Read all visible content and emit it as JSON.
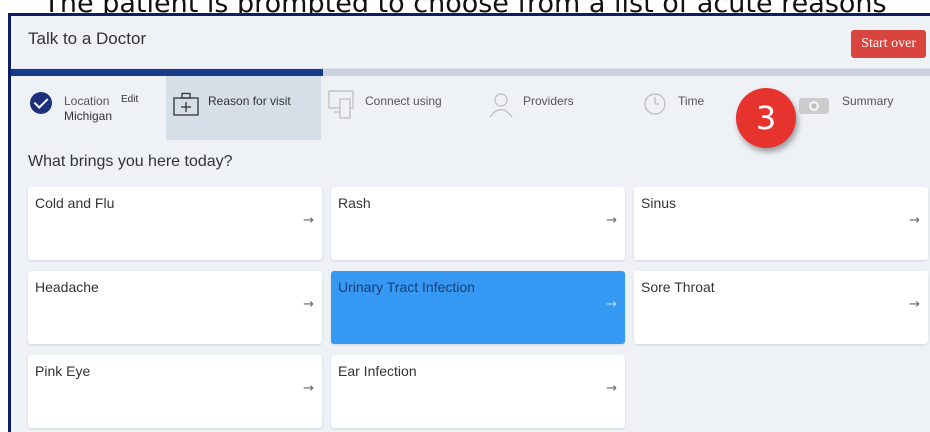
{
  "caption": "The patient is prompted to choose from a list of acute reasons",
  "header": {
    "title": "Talk to a Doctor",
    "start_over_label": "Start over"
  },
  "progress": {
    "completed_fraction": 0.34
  },
  "steps": [
    {
      "label": "Location",
      "edit_label": "Edit",
      "value": "Michigan",
      "state": "done"
    },
    {
      "label": "Reason for visit",
      "state": "current"
    },
    {
      "label": "Connect using",
      "state": "upcoming"
    },
    {
      "label": "Providers",
      "state": "upcoming"
    },
    {
      "label": "Time",
      "state": "upcoming"
    },
    {
      "label": "Summary",
      "state": "upcoming"
    }
  ],
  "badge": {
    "number": "3"
  },
  "question": "What brings you here today?",
  "reasons": [
    {
      "label": "Cold and Flu",
      "arrow": "→",
      "selected": false
    },
    {
      "label": "Rash",
      "arrow": "→",
      "selected": false
    },
    {
      "label": "Sinus",
      "arrow": "→",
      "selected": false
    },
    {
      "label": "Headache",
      "arrow": "→",
      "selected": false
    },
    {
      "label": "Urinary Tract Infection",
      "arrow": "→",
      "selected": true
    },
    {
      "label": "Sore Throat",
      "arrow": "→",
      "selected": false
    },
    {
      "label": "Pink Eye",
      "arrow": "→",
      "selected": false
    },
    {
      "label": "Ear Infection",
      "arrow": "→",
      "selected": false
    }
  ],
  "colors": {
    "accent": "#173a8a",
    "start_over": "#d9443f",
    "selected_card": "#3598f2",
    "badge": "#e7332e"
  },
  "icons": [
    "check-circle-icon",
    "medical-kit-icon",
    "devices-icon",
    "person-icon",
    "clock-icon",
    "camera-icon",
    "arrow-right-icon"
  ]
}
